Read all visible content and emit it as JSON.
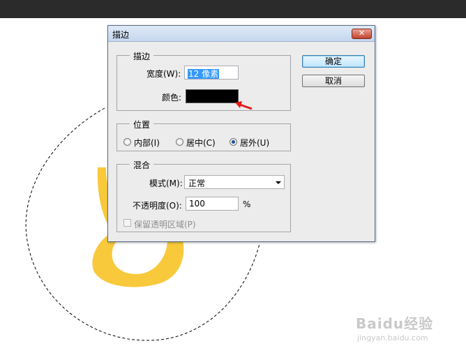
{
  "dialog": {
    "title": "描边",
    "close_label": "✕",
    "stroke_group": {
      "legend": "描边",
      "width_label": "宽度(W):",
      "width_value": "12 像素",
      "color_label": "颜色:",
      "color_value": "#000000"
    },
    "position_group": {
      "legend": "位置",
      "options": [
        {
          "label": "内部(I)",
          "selected": false
        },
        {
          "label": "居中(C)",
          "selected": false
        },
        {
          "label": "居外(U)",
          "selected": true
        }
      ]
    },
    "blend_group": {
      "legend": "混合",
      "mode_label": "模式(M):",
      "mode_value": "正常",
      "opacity_label": "不透明度(O):",
      "opacity_value": "100",
      "opacity_unit": "%",
      "preserve_label": "保留透明区域(P)"
    },
    "ok_label": "确定",
    "cancel_label": "取消"
  },
  "watermark": {
    "brand": "Baidu经验",
    "url": "jingyan.baidu.com"
  },
  "colors": {
    "accent_yellow": "#f8c93a",
    "annotation_arrow": "#e31b1b",
    "selection": "#3399ff"
  }
}
